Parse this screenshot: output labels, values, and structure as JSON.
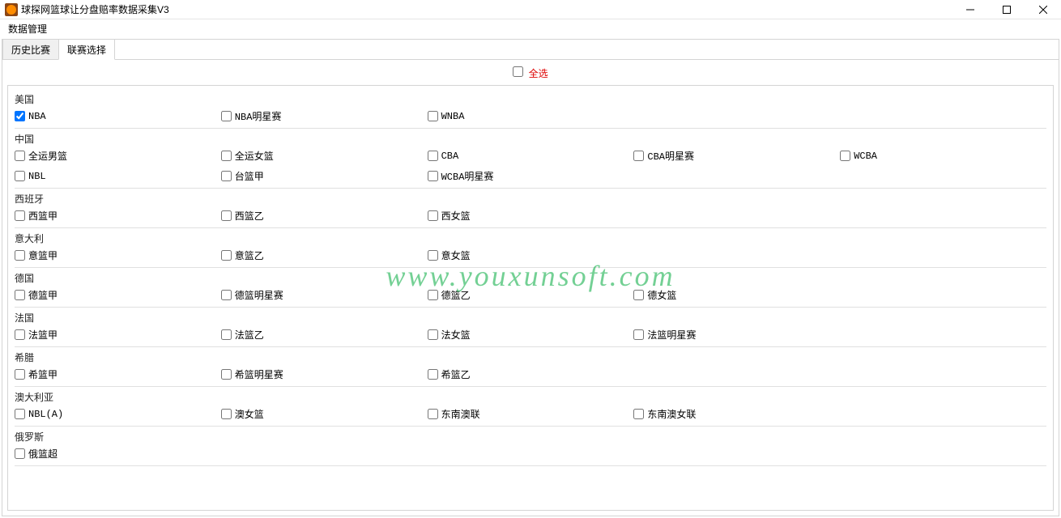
{
  "window": {
    "title": "球探网篮球让分盘赔率数据采集V3"
  },
  "menu": {
    "dataManage": "数据管理"
  },
  "tabs": {
    "history": "历史比赛",
    "leagueSelect": "联赛选择"
  },
  "selectAll": {
    "label": "全选",
    "checked": false
  },
  "watermark": "www.youxunsoft.com",
  "groups": [
    {
      "name": "美国",
      "leagues": [
        {
          "label": "NBA",
          "checked": true
        },
        {
          "label": "NBA明星赛",
          "checked": false
        },
        {
          "label": "WNBA",
          "checked": false
        }
      ]
    },
    {
      "name": "中国",
      "leagues": [
        {
          "label": "全运男篮",
          "checked": false
        },
        {
          "label": "全运女篮",
          "checked": false
        },
        {
          "label": "CBA",
          "checked": false
        },
        {
          "label": "CBA明星赛",
          "checked": false
        },
        {
          "label": "WCBA",
          "checked": false
        },
        {
          "label": "NBL",
          "checked": false
        },
        {
          "label": "台篮甲",
          "checked": false
        },
        {
          "label": "WCBA明星赛",
          "checked": false
        }
      ]
    },
    {
      "name": "西班牙",
      "leagues": [
        {
          "label": "西篮甲",
          "checked": false
        },
        {
          "label": "西篮乙",
          "checked": false
        },
        {
          "label": "西女篮",
          "checked": false
        }
      ]
    },
    {
      "name": "意大利",
      "leagues": [
        {
          "label": "意篮甲",
          "checked": false
        },
        {
          "label": "意篮乙",
          "checked": false
        },
        {
          "label": "意女篮",
          "checked": false
        }
      ]
    },
    {
      "name": "德国",
      "leagues": [
        {
          "label": "德篮甲",
          "checked": false
        },
        {
          "label": "德篮明星赛",
          "checked": false
        },
        {
          "label": "德篮乙",
          "checked": false
        },
        {
          "label": "德女篮",
          "checked": false
        }
      ]
    },
    {
      "name": "法国",
      "leagues": [
        {
          "label": "法篮甲",
          "checked": false
        },
        {
          "label": "法篮乙",
          "checked": false
        },
        {
          "label": "法女篮",
          "checked": false
        },
        {
          "label": "法篮明星赛",
          "checked": false
        }
      ]
    },
    {
      "name": "希腊",
      "leagues": [
        {
          "label": "希篮甲",
          "checked": false
        },
        {
          "label": "希篮明星赛",
          "checked": false
        },
        {
          "label": "希篮乙",
          "checked": false
        }
      ]
    },
    {
      "name": "澳大利亚",
      "leagues": [
        {
          "label": "NBL(A)",
          "checked": false
        },
        {
          "label": "澳女篮",
          "checked": false
        },
        {
          "label": "东南澳联",
          "checked": false
        },
        {
          "label": "东南澳女联",
          "checked": false
        }
      ]
    },
    {
      "name": "俄罗斯",
      "leagues": [
        {
          "label": "俄篮超",
          "checked": false
        }
      ]
    }
  ]
}
